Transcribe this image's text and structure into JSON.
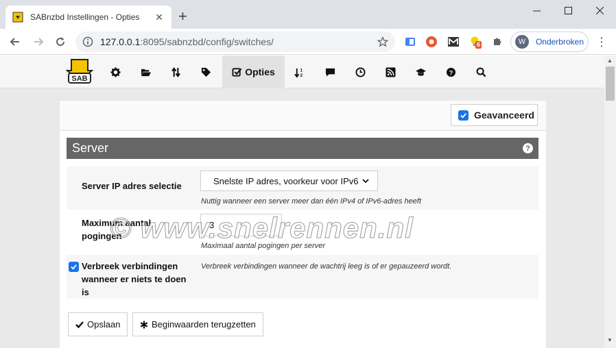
{
  "browser": {
    "tab_title": "SABnzbd Instellingen - Opties",
    "tab_close": "✕",
    "new_tab": "+",
    "url_host": "127.0.0.1",
    "url_path": ":8095/sabnzbd/config/switches/",
    "profile_initial": "W",
    "profile_label": "Onderbroken",
    "ext_badge": "6"
  },
  "nav": {
    "active_label": "Opties"
  },
  "advanced": {
    "label": "Geavanceerd",
    "checked": true
  },
  "section": {
    "title": "Server",
    "help": "?"
  },
  "fields": {
    "ip_select": {
      "label": "Server IP adres selectie",
      "value": "Snelste IP adres, voorkeur voor IPv6",
      "description": "Nuttig wanneer een server meer dan één IPv4 of IPv6-adres heeft"
    },
    "max_retries": {
      "label_line1": "Maximum aantal",
      "label_line2": "pogingen",
      "value": "3",
      "description": "Maximaal aantal pogingen per server"
    },
    "drop_connections": {
      "label_line1": "Verbreek verbindingen",
      "label_line2": "wanneer er niets te doen",
      "label_line3": "is",
      "checked": true,
      "description": "Verbreek verbindingen wanneer de wachtrij leeg is of er gepauzeerd wordt."
    }
  },
  "buttons": {
    "save": "Opslaan",
    "reset": "Beginwaarden terugzetten"
  },
  "watermark": "© www.snelrennen.nl",
  "colors": {
    "logo_yellow": "#f5c400",
    "checkbox_blue": "#1a73e8",
    "section_gray": "#666666"
  }
}
